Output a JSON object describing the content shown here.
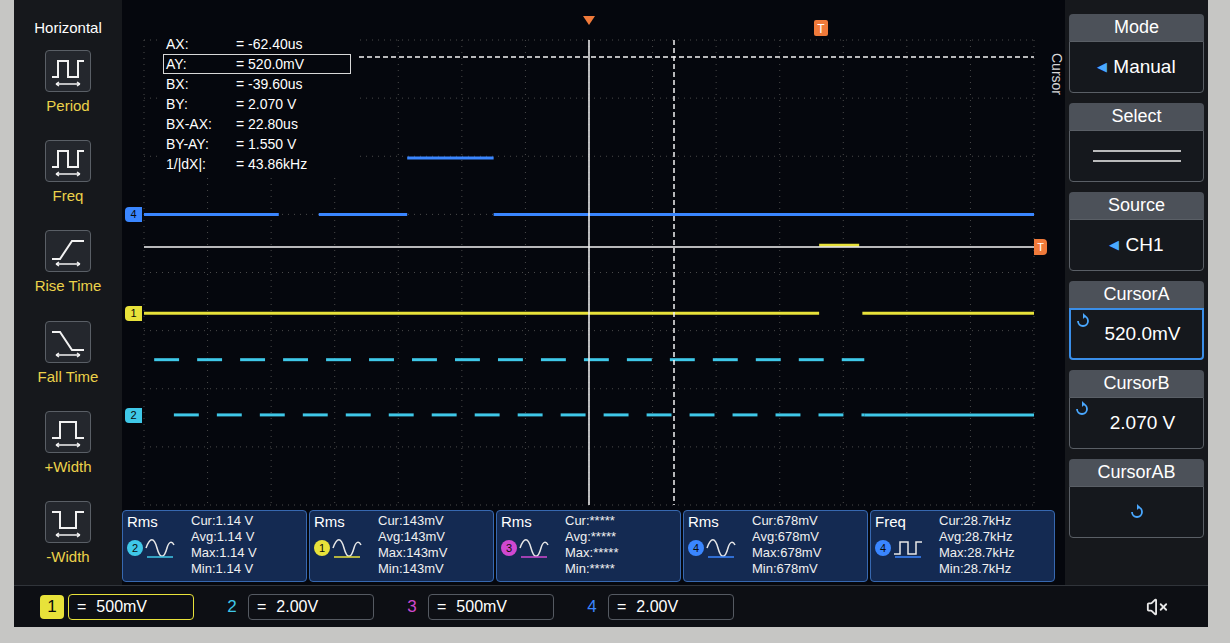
{
  "left_panel": {
    "title": "Horizontal",
    "items": [
      {
        "label": "Period",
        "kind": "period"
      },
      {
        "label": "Freq",
        "kind": "freq"
      },
      {
        "label": "Rise Time",
        "kind": "rise"
      },
      {
        "label": "Fall Time",
        "kind": "fall"
      },
      {
        "label": "+Width",
        "kind": "pwidth"
      },
      {
        "label": "-Width",
        "kind": "nwidth"
      }
    ]
  },
  "readout": [
    {
      "label": "AX:",
      "value": "= -62.40us",
      "selected": false
    },
    {
      "label": "AY:",
      "value": "= 520.0mV",
      "selected": true
    },
    {
      "label": "BX:",
      "value": "= -39.60us",
      "selected": false
    },
    {
      "label": "BY:",
      "value": "= 2.070 V",
      "selected": false
    },
    {
      "label": "BX-AX:",
      "value": "= 22.80us",
      "selected": false
    },
    {
      "label": "BY-AY:",
      "value": "= 1.550 V",
      "selected": false
    },
    {
      "label": "1/|dX|:",
      "value": "= 43.86kHz",
      "selected": false
    }
  ],
  "trigger": {
    "marker": "T",
    "level_marker": "T"
  },
  "cursor_label": "Cursor",
  "traces": [
    {
      "marker": "4",
      "color": "#3a86ff",
      "kind": "steps",
      "baseline": 3.0,
      "segments": [
        [
          0,
          2.12,
          3.0
        ],
        [
          2.75,
          4.14,
          3.0
        ],
        [
          4.14,
          5.5,
          2.03
        ],
        [
          5.5,
          14,
          3.0
        ]
      ]
    },
    {
      "marker": "1",
      "color": "#e8e23a",
      "kind": "steps",
      "baseline": 4.7,
      "segments": [
        [
          0,
          10.62,
          4.7
        ],
        [
          10.62,
          11.25,
          3.53
        ],
        [
          11.3,
          14,
          4.7
        ]
      ]
    },
    {
      "marker": "",
      "color": "#3fc8e8",
      "kind": "pulses",
      "baseline": 5.5,
      "x0": 0.16,
      "x1": 11.33,
      "period": 0.676,
      "duty": 0.58
    },
    {
      "marker": "2",
      "color": "#3fc8e8",
      "kind": "pulses",
      "baseline": 6.45,
      "x0": 0.47,
      "x1": 11.33,
      "period": 0.676,
      "duty": 0.58,
      "tail": [
        11.33,
        14
      ]
    }
  ],
  "measurements": [
    {
      "type": "Rms",
      "kind": "rms",
      "channel": "2",
      "color": "#3fc8e8",
      "cur": "Cur:1.14 V",
      "avg": "Avg:1.14 V",
      "max": "Max:1.14 V",
      "min": "Min:1.14 V"
    },
    {
      "type": "Rms",
      "kind": "rms",
      "channel": "1",
      "color": "#e8e23a",
      "cur": "Cur:143mV",
      "avg": "Avg:143mV",
      "max": "Max:143mV",
      "min": "Min:143mV"
    },
    {
      "type": "Rms",
      "kind": "rms",
      "channel": "3",
      "color": "#d048d0",
      "cur": "Cur:*****",
      "avg": "Avg:*****",
      "max": "Max:*****",
      "min": "Min:*****"
    },
    {
      "type": "Rms",
      "kind": "rms",
      "channel": "4",
      "color": "#3a86ff",
      "cur": "Cur:678mV",
      "avg": "Avg:678mV",
      "max": "Max:678mV",
      "min": "Min:678mV"
    },
    {
      "type": "Freq",
      "kind": "freq",
      "channel": "4",
      "color": "#3a86ff",
      "cur": "Cur:28.7kHz",
      "avg": "Avg:28.7kHz",
      "max": "Max:28.7kHz",
      "min": "Min:28.7kHz"
    }
  ],
  "channels": [
    {
      "number": "1",
      "coupling": "=",
      "scale": "500mV",
      "color": "#e8e23a",
      "selected": true
    },
    {
      "number": "2",
      "coupling": "=",
      "scale": "2.00V",
      "color": "#3fc8e8",
      "selected": false
    },
    {
      "number": "3",
      "coupling": "=",
      "scale": "500mV",
      "color": "#d048d0",
      "selected": false
    },
    {
      "number": "4",
      "coupling": "=",
      "scale": "2.00V",
      "color": "#3a86ff",
      "selected": false
    }
  ],
  "right_panel": [
    {
      "header": "Mode",
      "kind": "option",
      "arrow": "◀",
      "value": "Manual",
      "selected": false
    },
    {
      "header": "Select",
      "kind": "lines",
      "selected": false
    },
    {
      "header": "Source",
      "kind": "option",
      "arrow": "◀",
      "value": "CH1",
      "selected": false
    },
    {
      "header": "CursorA",
      "kind": "knob",
      "value": "520.0mV",
      "selected": true
    },
    {
      "header": "CursorB",
      "kind": "knob",
      "value": "2.070 V",
      "selected": false
    },
    {
      "header": "CursorAB",
      "kind": "icon",
      "selected": false
    }
  ]
}
